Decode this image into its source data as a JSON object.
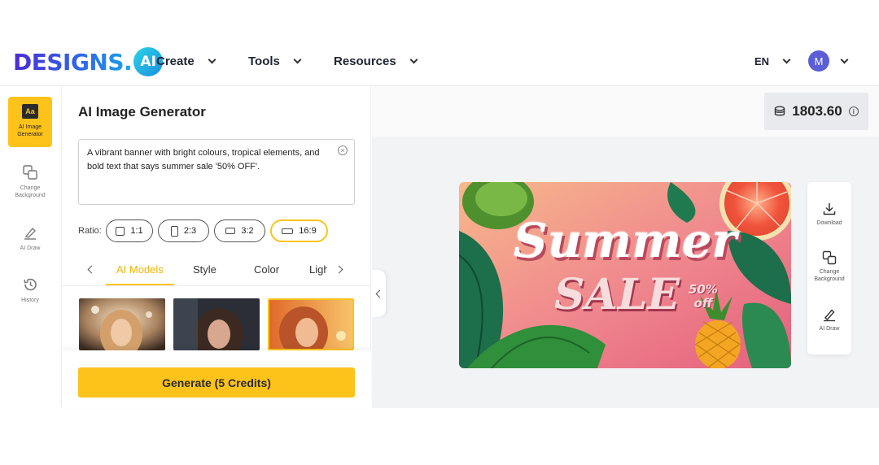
{
  "header": {
    "logo_text": "DESIGNS.",
    "logo_badge": "AI",
    "nav": [
      {
        "label": "Create"
      },
      {
        "label": "Tools"
      },
      {
        "label": "Resources"
      }
    ],
    "language": "EN",
    "avatar_initial": "M"
  },
  "sidebar": {
    "items": [
      {
        "label": "AI Image Generator",
        "icon": "aa-icon",
        "active": true
      },
      {
        "label": "Change Background",
        "icon": "layers-icon"
      },
      {
        "label": "AI Draw",
        "icon": "pen-icon"
      },
      {
        "label": "History",
        "icon": "history-icon"
      }
    ]
  },
  "panel": {
    "title": "AI Image Generator",
    "prompt": "A vibrant  banner with bright colours, tropical elements, and bold text that says summer sale '50% OFF'.",
    "ratio_label": "Ratio:",
    "ratios": [
      {
        "label": "1:1"
      },
      {
        "label": "2:3"
      },
      {
        "label": "3:2"
      },
      {
        "label": "16:9",
        "selected": true
      }
    ],
    "tabs": [
      {
        "label": "AI Models",
        "active": true
      },
      {
        "label": "Style"
      },
      {
        "label": "Color"
      },
      {
        "label": "Ligh"
      }
    ],
    "generate_label": "Generate (5 Credits)"
  },
  "canvas": {
    "credits": "1803.60",
    "banner": {
      "line1": "Summer",
      "line2": "SALE",
      "badge_line1": "50%",
      "badge_line2": "off"
    },
    "tools": [
      {
        "label": "Download",
        "icon": "download-icon"
      },
      {
        "label": "Change Background",
        "icon": "layers-icon"
      },
      {
        "label": "AI Draw",
        "icon": "pen-icon"
      }
    ]
  },
  "colors": {
    "accent": "#fdc31b",
    "accent_text": "#f0b400",
    "brand_purple": "#4b2bd6",
    "brand_cyan": "#17a6e8",
    "canvas_bg": "#f2f3f5"
  }
}
